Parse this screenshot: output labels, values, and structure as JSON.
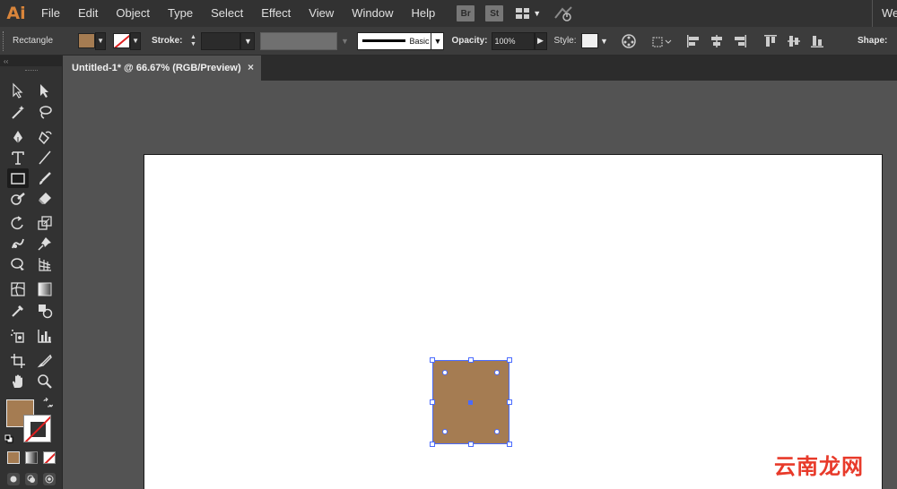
{
  "app": {
    "logo": "Ai",
    "menu": [
      "File",
      "Edit",
      "Object",
      "Type",
      "Select",
      "Effect",
      "View",
      "Window",
      "Help"
    ],
    "bridge_label": "Br",
    "stock_label": "St",
    "workspace_label": "Web"
  },
  "control_bar": {
    "tool_name": "Rectangle",
    "fill_color": "#a57c52",
    "stroke_label": "Stroke:",
    "stroke_value": "",
    "brush_label": "Basic",
    "opacity_label": "Opacity:",
    "opacity_value": "100%",
    "style_label": "Style:",
    "shape_label": "Shape:"
  },
  "document": {
    "tab_title": "Untitled-1* @ 66.67% (RGB/Preview)",
    "close_icon": "×"
  },
  "tools_panel": {
    "collapse_label": "‹‹",
    "fill_color": "#a57c52",
    "stroke_color": "none",
    "active_tool": "rectangle-tool"
  },
  "watermark": "云南龙网"
}
